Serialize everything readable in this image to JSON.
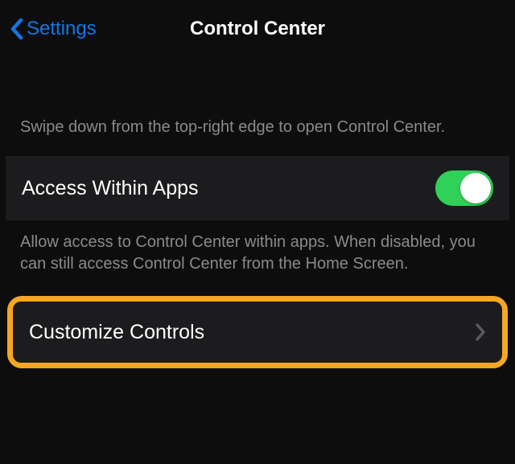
{
  "nav": {
    "back_label": "Settings",
    "title": "Control Center"
  },
  "section_header": "Swipe down from the top-right edge to open Control Center.",
  "access_row": {
    "label": "Access Within Apps",
    "enabled": true
  },
  "access_footer": "Allow access to Control Center within apps. When disabled, you can still access Control Center from the Home Screen.",
  "customize_row": {
    "label": "Customize Controls"
  },
  "colors": {
    "accent": "#1376e6",
    "toggle_on": "#30d158",
    "highlight": "#f5a623"
  }
}
